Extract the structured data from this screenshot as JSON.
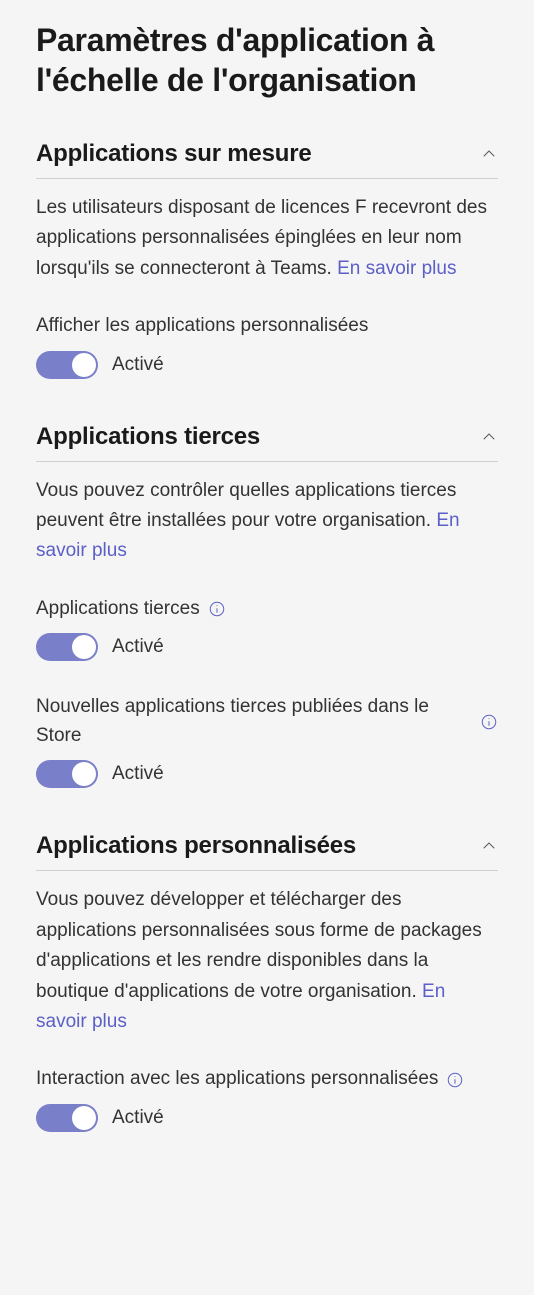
{
  "page": {
    "title": "Paramètres d'application à l'échelle de l'organisation"
  },
  "sections": {
    "tailored": {
      "title": "Applications sur mesure",
      "desc_before": "Les utilisateurs disposant de licences F recevront des applications personnalisées épinglées en leur nom lorsqu'ils se connecteront à Teams. ",
      "learn_more": "En savoir plus",
      "show_tailored": {
        "label": "Afficher les applications personnalisées",
        "status": "Activé"
      }
    },
    "thirdparty": {
      "title": "Applications tierces",
      "desc_before": "Vous pouvez contrôler quelles applications tierces peuvent être installées pour votre organisation. ",
      "learn_more": "En savoir plus",
      "apps": {
        "label": "Applications tierces",
        "status": "Activé"
      },
      "new_apps": {
        "label": "Nouvelles applications tierces publiées dans le Store",
        "status": "Activé"
      }
    },
    "custom": {
      "title": "Applications personnalisées",
      "desc_before": "Vous pouvez développer et télécharger des applications personnalisées sous forme de packages d'applications et les rendre disponibles dans la boutique d'applications de votre organisation. ",
      "learn_more": "En savoir plus",
      "interaction": {
        "label": "Interaction avec les applications personnalisées",
        "status": "Activé"
      }
    }
  }
}
